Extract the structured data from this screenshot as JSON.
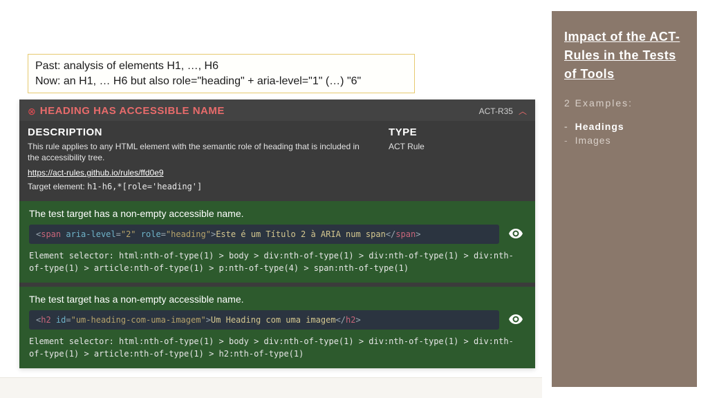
{
  "sidebar": {
    "title": "Impact of the ACT-Rules in the Tests of Tools",
    "sub": "2 Examples:",
    "items": [
      "Headings",
      "Images"
    ],
    "active_index": 0
  },
  "callout": {
    "line1": "Past: analysis of elements H1, …, H6",
    "line2": "Now: an H1, … H6 but also role=\"heading\" + aria-level=\"1\" (…) \"6\""
  },
  "panel": {
    "title": "HEADING HAS ACCESSIBLE NAME",
    "rule_id": "ACT-R35",
    "description_heading": "DESCRIPTION",
    "description_text": "This rule applies to any HTML element with the semantic role of heading that is included in the accessibility tree.",
    "link": "https://act-rules.github.io/rules/ffd0e9",
    "target_label": "Target element:",
    "target_code": "h1-h6,*[role='heading']",
    "type_heading": "TYPE",
    "type_value": "ACT Rule"
  },
  "results": [
    {
      "title": "The test target has a non-empty accessible name.",
      "code_tokens": [
        {
          "cls": "tk-angle",
          "t": "<"
        },
        {
          "cls": "tk-tag",
          "t": "span"
        },
        {
          "cls": "",
          "t": " "
        },
        {
          "cls": "tk-attr",
          "t": "aria-level"
        },
        {
          "cls": "tk-angle",
          "t": "="
        },
        {
          "cls": "tk-str",
          "t": "\"2\""
        },
        {
          "cls": "",
          "t": " "
        },
        {
          "cls": "tk-attr",
          "t": "role"
        },
        {
          "cls": "tk-angle",
          "t": "="
        },
        {
          "cls": "tk-str",
          "t": "\"heading\""
        },
        {
          "cls": "tk-angle",
          "t": ">"
        },
        {
          "cls": "tk-text",
          "t": "Este é um Título 2 à ARIA num span"
        },
        {
          "cls": "tk-angle",
          "t": "</"
        },
        {
          "cls": "tk-tag",
          "t": "span"
        },
        {
          "cls": "tk-angle",
          "t": ">"
        }
      ],
      "selector_label": "Element selector:",
      "selector": "html:nth-of-type(1) > body > div:nth-of-type(1) > div:nth-of-type(1) > div:nth-of-type(1) > article:nth-of-type(1) > p:nth-of-type(4) > span:nth-of-type(1)"
    },
    {
      "title": "The test target has a non-empty accessible name.",
      "code_tokens": [
        {
          "cls": "tk-angle",
          "t": "<"
        },
        {
          "cls": "tk-tag",
          "t": "h2"
        },
        {
          "cls": "",
          "t": " "
        },
        {
          "cls": "tk-attr",
          "t": "id"
        },
        {
          "cls": "tk-angle",
          "t": "="
        },
        {
          "cls": "tk-str",
          "t": "\"um-heading-com-uma-imagem\""
        },
        {
          "cls": "tk-angle",
          "t": ">"
        },
        {
          "cls": "tk-text",
          "t": "Um Heading com uma imagem"
        },
        {
          "cls": "tk-angle",
          "t": "</"
        },
        {
          "cls": "tk-tag",
          "t": "h2"
        },
        {
          "cls": "tk-angle",
          "t": ">"
        }
      ],
      "selector_label": "Element selector:",
      "selector": "html:nth-of-type(1) > body > div:nth-of-type(1) > div:nth-of-type(1) > div:nth-of-type(1) > article:nth-of-type(1) > h2:nth-of-type(1)"
    }
  ]
}
